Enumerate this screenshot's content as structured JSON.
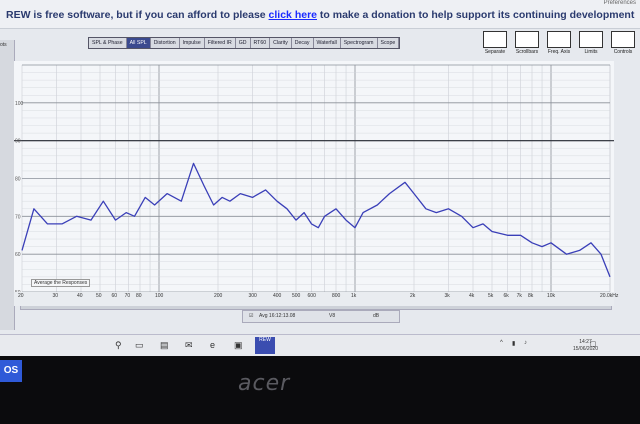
{
  "banner": {
    "prefix": "REW is free software, but if you can afford to please ",
    "link": "click here",
    "suffix": " to make a donation to help support its continuing development"
  },
  "preferences_label": "Preferences",
  "tabs": [
    "SPL & Phase",
    "All SPL",
    "Distortion",
    "Impulse",
    "Filtered IR",
    "GD",
    "RT60",
    "Clarity",
    "Decay",
    "Waterfall",
    "Spectrogram",
    "Scope"
  ],
  "active_tab": "All SPL",
  "tools": [
    "Separate",
    "Scrollbars",
    "Freq. Axis",
    "Limits",
    "Controls"
  ],
  "left_strip_label": "ots",
  "y_axis_ticks": [
    "100",
    "90",
    "80",
    "70",
    "60",
    "50"
  ],
  "x_axis_ticks": [
    "20",
    "30",
    "40",
    "50",
    "60",
    "70",
    "80",
    "100",
    "200",
    "300",
    "400",
    "500",
    "600",
    "800",
    "1k",
    "2k",
    "3k",
    "4k",
    "5k",
    "6k",
    "7k",
    "8k",
    "10k",
    "20.0kHz"
  ],
  "x_axis_first": "20",
  "avg_label": "Average the Responses",
  "overlay_text": "Avg 16:12:13.08",
  "overlay_mid": "V8",
  "overlay_right": "dB",
  "taskbar_clock": {
    "time": "14:27",
    "date": "15/06/2020"
  },
  "rew_button": "REW",
  "os_badge": "OS",
  "brand": "acer",
  "chart_data": {
    "type": "line",
    "series": [
      {
        "x": [
          20,
          23,
          27,
          32,
          38,
          45,
          52,
          60,
          68,
          75,
          85,
          95,
          110,
          130,
          150,
          170,
          190,
          210,
          230,
          260,
          300,
          350,
          400,
          450,
          500,
          550,
          600,
          650,
          700,
          800,
          900,
          1000,
          1100,
          1300,
          1500,
          1800,
          2000,
          2300,
          2600,
          3000,
          3500,
          4000,
          4500,
          5000,
          6000,
          7000,
          8000,
          9000,
          10000,
          12000,
          14000,
          16000,
          18000,
          20000
        ],
        "values": [
          61,
          72,
          68,
          68,
          70,
          69,
          74,
          69,
          71,
          70,
          75,
          73,
          76,
          74,
          84,
          78,
          73,
          75,
          74,
          76,
          75,
          77,
          74,
          72,
          69,
          71,
          68,
          67,
          70,
          72,
          69,
          67,
          71,
          73,
          76,
          79,
          76,
          72,
          71,
          72,
          70,
          67,
          68,
          66,
          65,
          65,
          63,
          62,
          63,
          60,
          61,
          63,
          60,
          54
        ]
      }
    ],
    "ylim": [
      50,
      110
    ]
  }
}
